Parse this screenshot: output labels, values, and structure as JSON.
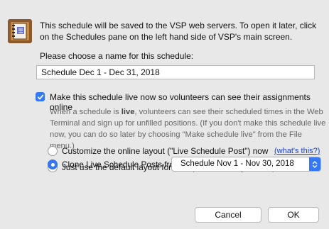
{
  "dialog": {
    "intro": "This schedule will be saved to the VSP web servers. To open it later, click on the Schedules pane on the left hand side of VSP's main screen.",
    "name_prompt": "Please choose a name for this schedule:",
    "name_value": "Schedule Dec 1 - Dec 31, 2018",
    "live_checkbox": {
      "label": "Make this schedule live now so volunteers can see their assignments online",
      "checked": true
    },
    "live_description": {
      "before": "When a schedule is ",
      "emphasis": "live",
      "after": ", volunteers can see their scheduled times in the Web Terminal and sign up for unfilled positions. (If you don't make this schedule live now, you can do so later by choosing \"Make schedule live\" from the File menu.)"
    },
    "options": {
      "customize_label": "Customize the online layout (\"Live Schedule Post\") now",
      "whats_this": "(what's this?)",
      "default_label": "Just use the default layout for now (can be changed later)",
      "clone_label": "Clone Live Schedule Posts from",
      "clone_selected": "Schedule Nov 1 - Nov 30, 2018",
      "selected_option": "clone"
    },
    "buttons": {
      "cancel": "Cancel",
      "ok": "OK"
    }
  },
  "icons": {
    "app": "vsp-app-icon",
    "select_arrows": "chevron-updown-icon",
    "check": "checkmark-icon"
  },
  "colors": {
    "accent": "#3478f6",
    "link": "#1a3fc8",
    "background": "#e8e8e8"
  }
}
